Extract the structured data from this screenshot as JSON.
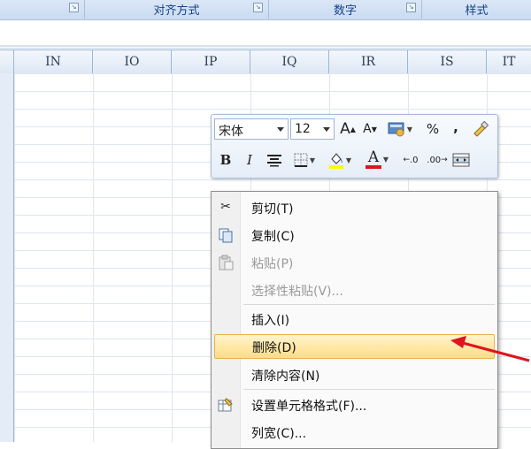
{
  "ribbon": {
    "groups": [
      "对齐方式",
      "数字",
      "样式"
    ]
  },
  "columns": [
    "IN",
    "IO",
    "IP",
    "IQ",
    "IR",
    "IS",
    "IT"
  ],
  "mini_toolbar": {
    "font_name": "宋体",
    "font_size": "12",
    "grow_font_label": "A",
    "shrink_font_label": "A",
    "percent_label": "%",
    "comma_label": ",",
    "bold_label": "B",
    "italic_label": "I",
    "font_color_label": "A",
    "inc_decimal_label": ".0",
    "dec_decimal_label": ".00"
  },
  "context_menu": {
    "items": [
      {
        "label": "剪切(T)",
        "icon": "scissors-icon",
        "enabled": true
      },
      {
        "label": "复制(C)",
        "icon": "copy-icon",
        "enabled": true
      },
      {
        "label": "粘贴(P)",
        "icon": "paste-icon",
        "enabled": false
      },
      {
        "label": "选择性粘贴(V)...",
        "icon": "",
        "enabled": false
      },
      {
        "label": "插入(I)",
        "icon": "",
        "enabled": true
      },
      {
        "label": "删除(D)",
        "icon": "",
        "enabled": true,
        "highlighted": true
      },
      {
        "label": "清除内容(N)",
        "icon": "",
        "enabled": true
      },
      {
        "label": "设置单元格格式(F)...",
        "icon": "format-cells-icon",
        "enabled": true
      },
      {
        "label": "列宽(C)...",
        "icon": "",
        "enabled": true
      }
    ]
  },
  "colors": {
    "highlight_top": "#fff4cf",
    "highlight_bottom": "#ffdc84",
    "annotation_arrow": "#e0141e",
    "font_color_bar": "#e0141e",
    "fill_color_bar": "#ffff00"
  }
}
